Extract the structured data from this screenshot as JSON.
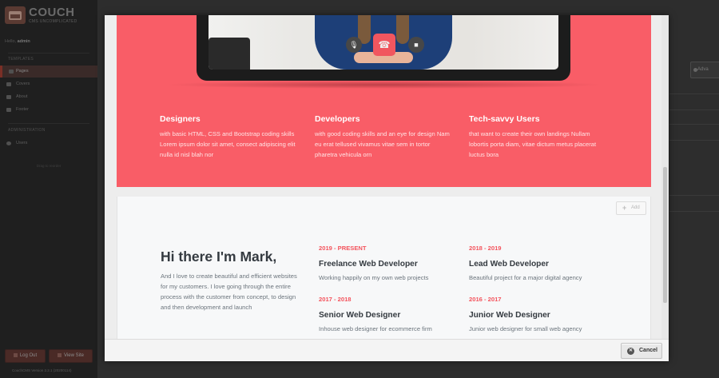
{
  "sidebar": {
    "logo_name": "COUCH",
    "logo_tagline": "CMS UNCOMPLICATED",
    "greeting": "Hello,",
    "username": "admin",
    "section_templates": "TEMPLATES",
    "items": [
      {
        "label": "Pages",
        "icon": "page-icon"
      },
      {
        "label": "Covers",
        "icon": "document-icon"
      },
      {
        "label": "About",
        "icon": "document-icon"
      },
      {
        "label": "Footer",
        "icon": "document-icon"
      }
    ],
    "section_admin": "ADMINISTRATION",
    "users_label": "Users",
    "hint": "Drag to reorder",
    "logout_label": "Log Out",
    "viewsite_label": "View Site",
    "version": "CouchCMS Version 2.2.1 (20200114)"
  },
  "background": {
    "admin_button_label": "Adva"
  },
  "hero": {
    "call_buttons": [
      {
        "name": "mute",
        "icon": "mic-off-icon",
        "glyph": "🎙"
      },
      {
        "name": "end-call",
        "icon": "phone-hangup-icon",
        "glyph": "☎"
      },
      {
        "name": "camera",
        "icon": "video-camera-icon",
        "glyph": "■"
      }
    ],
    "features": [
      {
        "title": "Designers",
        "text": "with basic HTML, CSS and Bootstrap coding skills Lorem ipsum dolor sit amet, consect adipiscing elit nulla id nisl blah nor"
      },
      {
        "title": "Developers",
        "text": "with good coding skills and an eye for design Nam eu erat tellused vivamus vitae sem in tortor pharetra vehicula orn"
      },
      {
        "title": "Tech-savvy Users",
        "text": "that want to create their own landings Nullam lobortis porta diam, vitae dictum metus placerat luctus bora"
      }
    ],
    "color": "#f95d67"
  },
  "resume": {
    "add_label": "Add",
    "title": "Hi there I'm Mark,",
    "intro": "And I love to create beautiful and efficient websites for my customers. I love going through the entire process with the customer from concept, to design and then development and launch",
    "jobs": [
      {
        "years": "2019 - PRESENT",
        "role": "Freelance Web Developer",
        "desc": "Working happily on my own web projects"
      },
      {
        "years": "2018 - 2019",
        "role": "Lead Web Developer",
        "desc": "Beautiful project for a major digital agency"
      },
      {
        "years": "2017 - 2018",
        "role": "Senior Web Designer",
        "desc": "Inhouse web designer for ecommerce firm"
      },
      {
        "years": "2016 - 2017",
        "role": "Junior Web Designer",
        "desc": "Junior web designer for small web agency"
      }
    ],
    "accent": "#f4535c"
  },
  "modal": {
    "cancel_label": "Cancel"
  }
}
